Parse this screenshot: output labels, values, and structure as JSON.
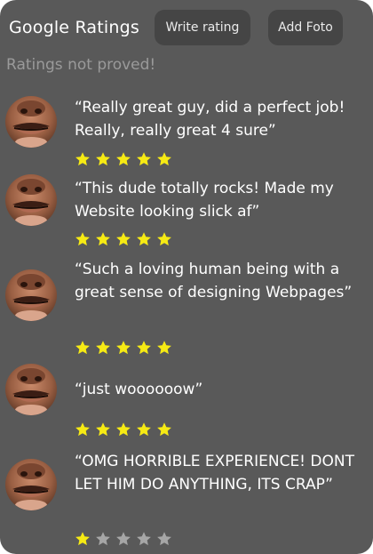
{
  "header": {
    "title": "Google Ratings",
    "write_rating_label": "Write rating",
    "add_foto_label": "Add Foto",
    "disclaimer": "Ratings not proved!"
  },
  "colors": {
    "card_background": "#595959",
    "button_background": "#454545",
    "star_filled": "#f6ea14",
    "star_empty": "#a6a6a6",
    "disclaimer_text": "#9a9a9a"
  },
  "reviews": [
    {
      "text": "“Really great guy, did a perfect job! Really, really great 4 sure”",
      "rating": 5,
      "max_rating": 5,
      "avatar_icon": "reviewer-avatar-photo"
    },
    {
      "text": "“This dude totally rocks! Made my Website looking slick af”",
      "rating": 5,
      "max_rating": 5,
      "avatar_icon": "reviewer-avatar-photo"
    },
    {
      "text": "“Such a loving human being with a great sense of designing Webpages”",
      "rating": 5,
      "max_rating": 5,
      "avatar_icon": "reviewer-avatar-photo"
    },
    {
      "text": "“just woooooow”",
      "rating": 5,
      "max_rating": 5,
      "avatar_icon": "reviewer-avatar-photo"
    },
    {
      "text": "“OMG HORRIBLE EXPERIENCE! DONT LET HIM DO ANYTHING, ITS CRAP”",
      "rating": 1,
      "max_rating": 5,
      "avatar_icon": "reviewer-avatar-photo"
    }
  ]
}
